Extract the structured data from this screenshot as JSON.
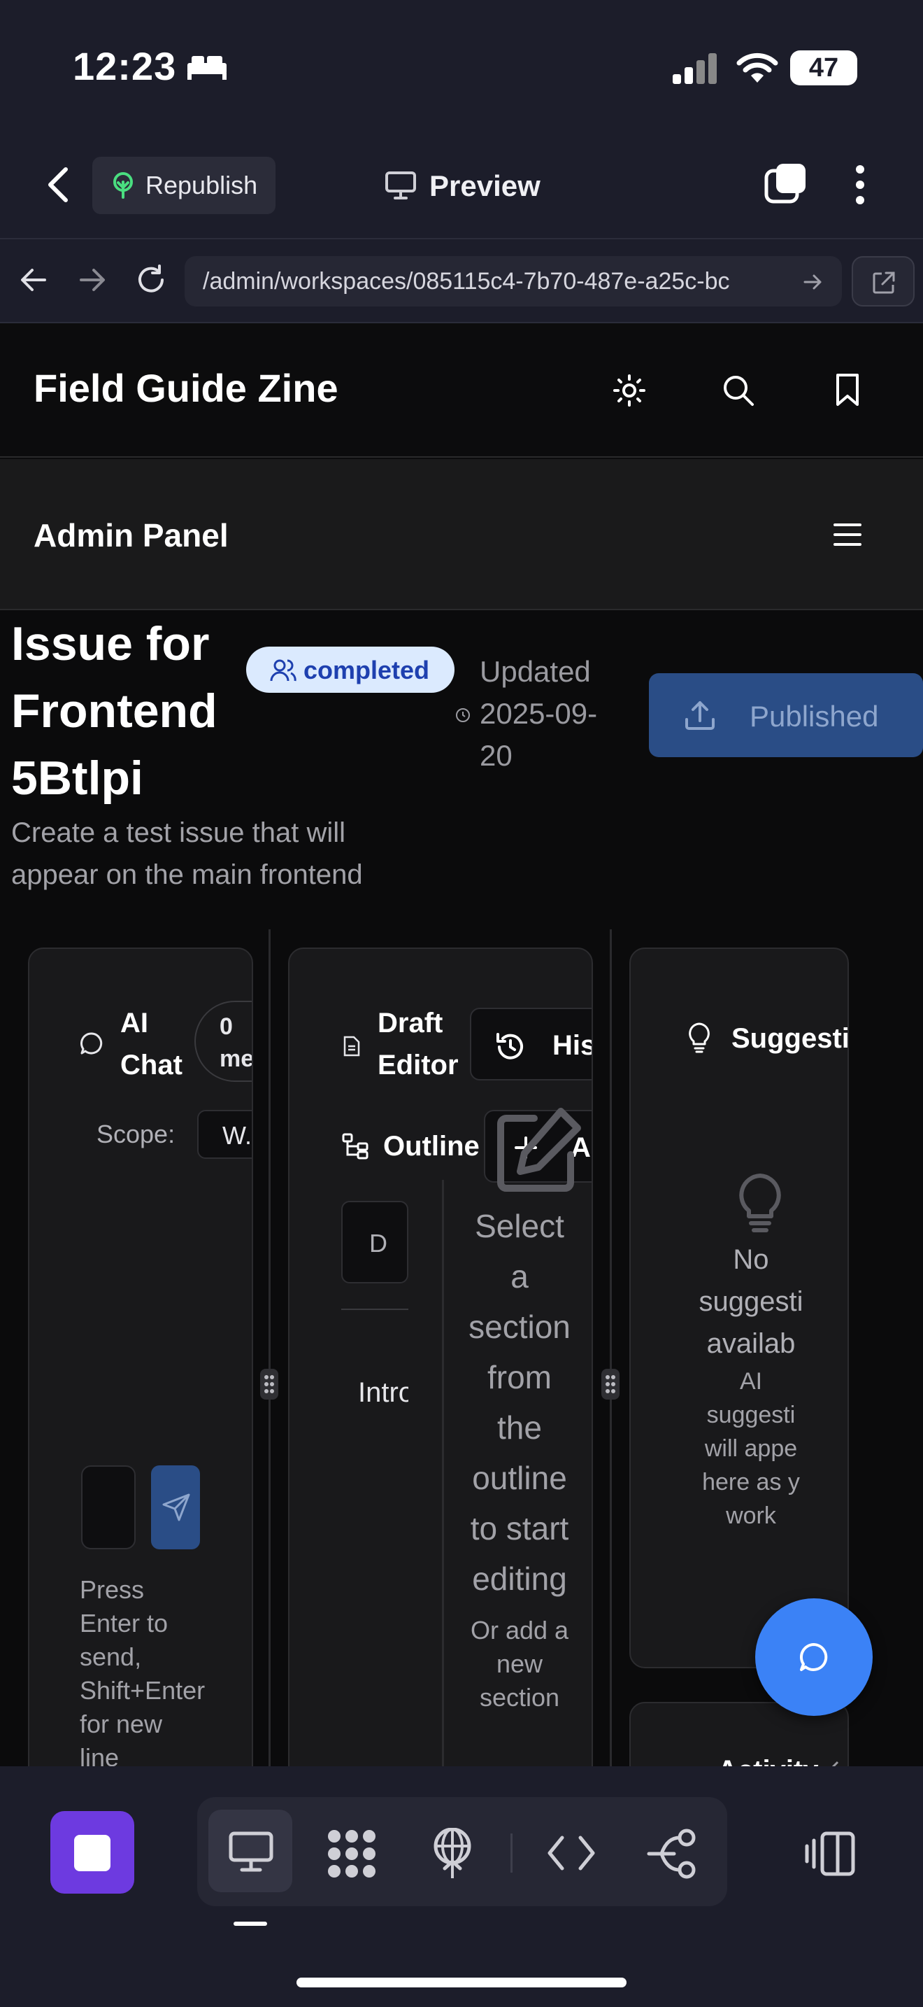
{
  "status_bar": {
    "time": "12:23",
    "battery": "47"
  },
  "browser": {
    "republish_label": "Republish",
    "preview_label": "Preview",
    "url": "/admin/workspaces/085115c4-7b70-487e-a25c-bc"
  },
  "site": {
    "title": "Field Guide Zine",
    "admin_label": "Admin Panel"
  },
  "issue": {
    "title_line1": "Issue for",
    "title_line2": "Frontend",
    "title_line3": "5Btlpi",
    "status_badge": "completed",
    "updated_line1": "Updated",
    "updated_line2": "2025-09-",
    "updated_line3": "20",
    "publish_button": "Published",
    "description_line1": "Create a test issue that will",
    "description_line2": "appear on the main frontend"
  },
  "ai_chat": {
    "title_line1": "AI",
    "title_line2": "Chat",
    "count_line1": "0",
    "count_line2": "mes",
    "scope_label": "Scope:",
    "scope_value": "W...",
    "hint_lines": [
      "Press",
      "Enter to",
      "send,",
      "Shift+Enter",
      "for new",
      "line"
    ]
  },
  "draft_editor": {
    "title_line1": "Draft",
    "title_line2": "Editor",
    "history_label": "Hist",
    "outline_label": "Outline",
    "add_label": "Add",
    "outline_item": "Intro",
    "outline_input": "D",
    "select_lines": [
      "Select",
      "a",
      "section",
      "from",
      "the",
      "outline",
      "to start",
      "editing"
    ],
    "add_hint_lines": [
      "Or add a",
      "new",
      "section"
    ]
  },
  "suggestions": {
    "title": "Suggestio",
    "empty_lines": [
      "No",
      "suggesti",
      "availab"
    ],
    "empty_hint_lines": [
      "AI",
      "suggesti",
      "will appe",
      "here as y",
      "work"
    ],
    "activity_label": "Activity"
  },
  "colors": {
    "accent_blue": "#3b82f6",
    "badge_bg": "#dbeafe",
    "badge_text": "#1e40af",
    "published_bg": "#2a4d86",
    "dock_purple": "#6d3ae0"
  }
}
